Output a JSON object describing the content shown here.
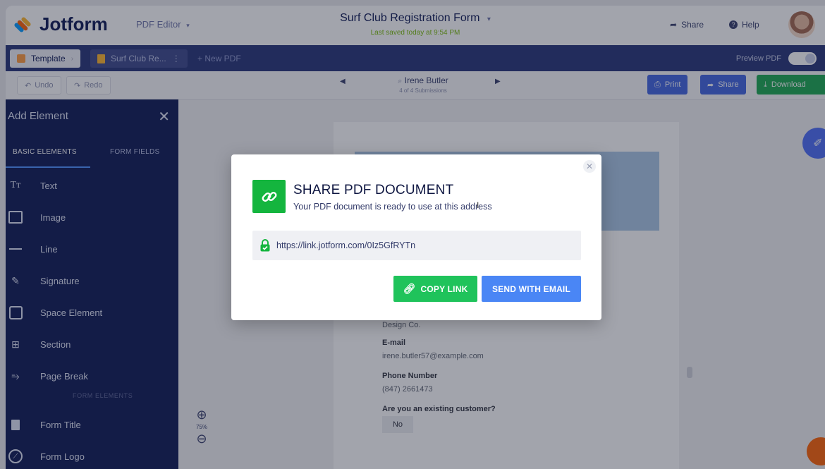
{
  "header": {
    "logo_text": "Jotform",
    "mode_label": "PDF Editor",
    "doc_title": "Surf Club Registration Form",
    "doc_subtitle": "Last saved today at 9:54 PM",
    "share_label": "Share",
    "help_label": "Help"
  },
  "tabs": {
    "template_label": "Template",
    "doc_tab_label": "Surf Club Re...",
    "new_pdf_label": "+ New PDF",
    "preview_label": "Preview PDF"
  },
  "toolbar": {
    "undo_label": "Undo",
    "redo_label": "Redo",
    "submission_name": "Irene Butler",
    "submission_count": "4 of 4 Submissions",
    "print_label": "Print",
    "share_label": "Share",
    "download_label": "Download"
  },
  "sidebar": {
    "title": "Add Element",
    "tab_basic": "BASIC ELEMENTS",
    "tab_form": "FORM FIELDS",
    "section_heading": "FORM ELEMENTS",
    "items": [
      {
        "label": "Text",
        "icon": "text-icon"
      },
      {
        "label": "Image",
        "icon": "image-icon"
      },
      {
        "label": "Line",
        "icon": "line-icon"
      },
      {
        "label": "Signature",
        "icon": "signature-icon"
      },
      {
        "label": "Space Element",
        "icon": "space-icon"
      },
      {
        "label": "Section",
        "icon": "section-icon"
      },
      {
        "label": "Page Break",
        "icon": "page-break-icon"
      },
      {
        "label": "Form Title",
        "icon": "form-title-icon"
      },
      {
        "label": "Form Logo",
        "icon": "form-logo-icon"
      }
    ]
  },
  "canvas": {
    "company_value": "Design Co.",
    "email_label": "E-mail",
    "email_value": "irene.butler57@example.com",
    "phone_label": "Phone Number",
    "phone_value": "(847) 2661473",
    "customer_label": "Are you an existing customer?",
    "customer_value": "No",
    "zoom_level": "75%"
  },
  "modal": {
    "title": "SHARE PDF DOCUMENT",
    "subtitle": "Your PDF document is ready to use at this address",
    "url": "https://link.jotform.com/0Iz5GfRYTn",
    "copy_label": "COPY LINK",
    "email_label": "SEND WITH EMAIL",
    "colors": {
      "copy": "#1fc35b",
      "email": "#4a86f5",
      "icon_bg": "#14b53e"
    }
  }
}
